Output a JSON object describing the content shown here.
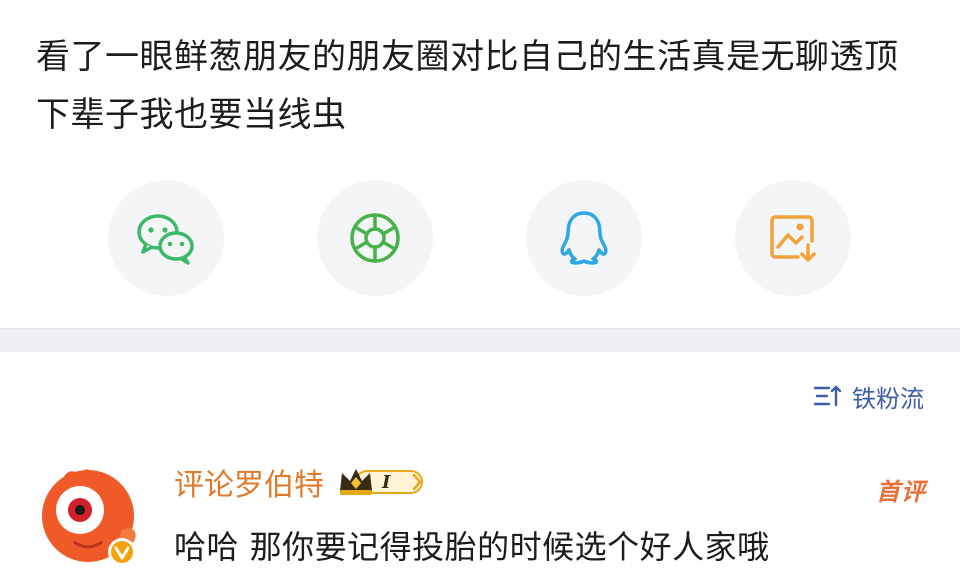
{
  "post": {
    "text": "看了一眼鲜葱朋友的朋友圈对比自己的生活真是无聊透顶 下辈子我也要当线虫"
  },
  "share": {
    "buttons": [
      {
        "name": "wechat",
        "icon": "wechat-icon",
        "color": "#3cb868"
      },
      {
        "name": "moments",
        "icon": "moments-icon",
        "color": "#47b24a"
      },
      {
        "name": "qq",
        "icon": "qq-icon",
        "color": "#2ea7e6"
      },
      {
        "name": "save-image",
        "icon": "save-image-icon",
        "color": "#f2a23a"
      }
    ]
  },
  "comments_header": {
    "sort_label": "铁粉流",
    "sort_icon": "sort-icon"
  },
  "comment": {
    "user_name": "评论罗伯特",
    "level": "I",
    "tag": "首评",
    "text": "哈哈 那你要记得投胎的时候选个好人家哦"
  },
  "colors": {
    "username": "#e07a2a",
    "link_blue": "#3d5fa8",
    "tag_orange": "#e8703a",
    "divider": "#eef0f3"
  }
}
